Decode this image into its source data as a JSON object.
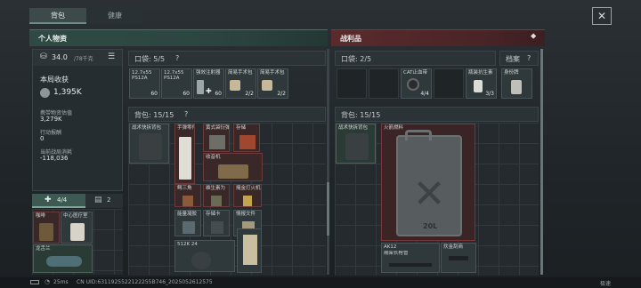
{
  "tabs": [
    {
      "label": "背包"
    },
    {
      "label": "健康"
    }
  ],
  "left": {
    "title": "个人物资",
    "weight": "34.0",
    "weight_max": "/78千克",
    "income_label": "本局收获",
    "income_value": "1,395K",
    "carry_label": "携带物资估值",
    "carry_value": "3,279K",
    "action_label": "行动报酬",
    "action_value": "0",
    "cost_label": "当前战局消耗",
    "cost_value": "-118,036",
    "tab_a": "4/4",
    "tab_b": "2",
    "pocket": {
      "label": "口袋: 5/5",
      "help": "?"
    },
    "pocket_items": [
      {
        "name": "12.7x55 PS12A",
        "count": "60"
      },
      {
        "name": "12.7x55 PS12A",
        "count": "60"
      },
      {
        "name": "强效注射器",
        "count": "60"
      },
      {
        "name": "简易手术包",
        "count": "2/2"
      },
      {
        "name": "简易手术包",
        "count": "2/2"
      }
    ],
    "backpack": {
      "label": "背包: 15/15",
      "help": "?"
    },
    "items": {
      "i0": "战术快拆背包",
      "i1": "手弹零件机",
      "i2": "黄式袋衍弹",
      "i3": "存储",
      "i4": "收音机",
      "i5": "鳄三角",
      "i6": "维生素为",
      "i7": "掩金打火机",
      "i8": "能量凝胶",
      "i9": "存储卡",
      "i10": "情报文件",
      "i11": "512K 24"
    },
    "side_items": [
      {
        "name": "咖啡"
      },
      {
        "name": "中心医疗室"
      },
      {
        "name": "龙舌兰"
      }
    ]
  },
  "right": {
    "title": "战利品",
    "pocket": {
      "label": "口袋: 2/5"
    },
    "archive": {
      "label": "档案",
      "help": "?"
    },
    "pocket_items": [
      {
        "name": "CAT止血带",
        "count": "4/4"
      },
      {
        "name": "瓶装抗生素",
        "count": "3/3"
      },
      {
        "name": "身份牌"
      }
    ],
    "backpack": {
      "label": "背包: 15/15"
    },
    "items": {
      "bag": "战术快拆背包",
      "fuel": "火箭燃料",
      "fuel_label": "20L",
      "ak": "AK12",
      "ak_sub": "期架长枪管",
      "knife": "炊金刮商"
    }
  },
  "status": {
    "ping": "25ms",
    "uid": "CN UID:6311925522122255B746_2025052612575",
    "right": "极速"
  }
}
